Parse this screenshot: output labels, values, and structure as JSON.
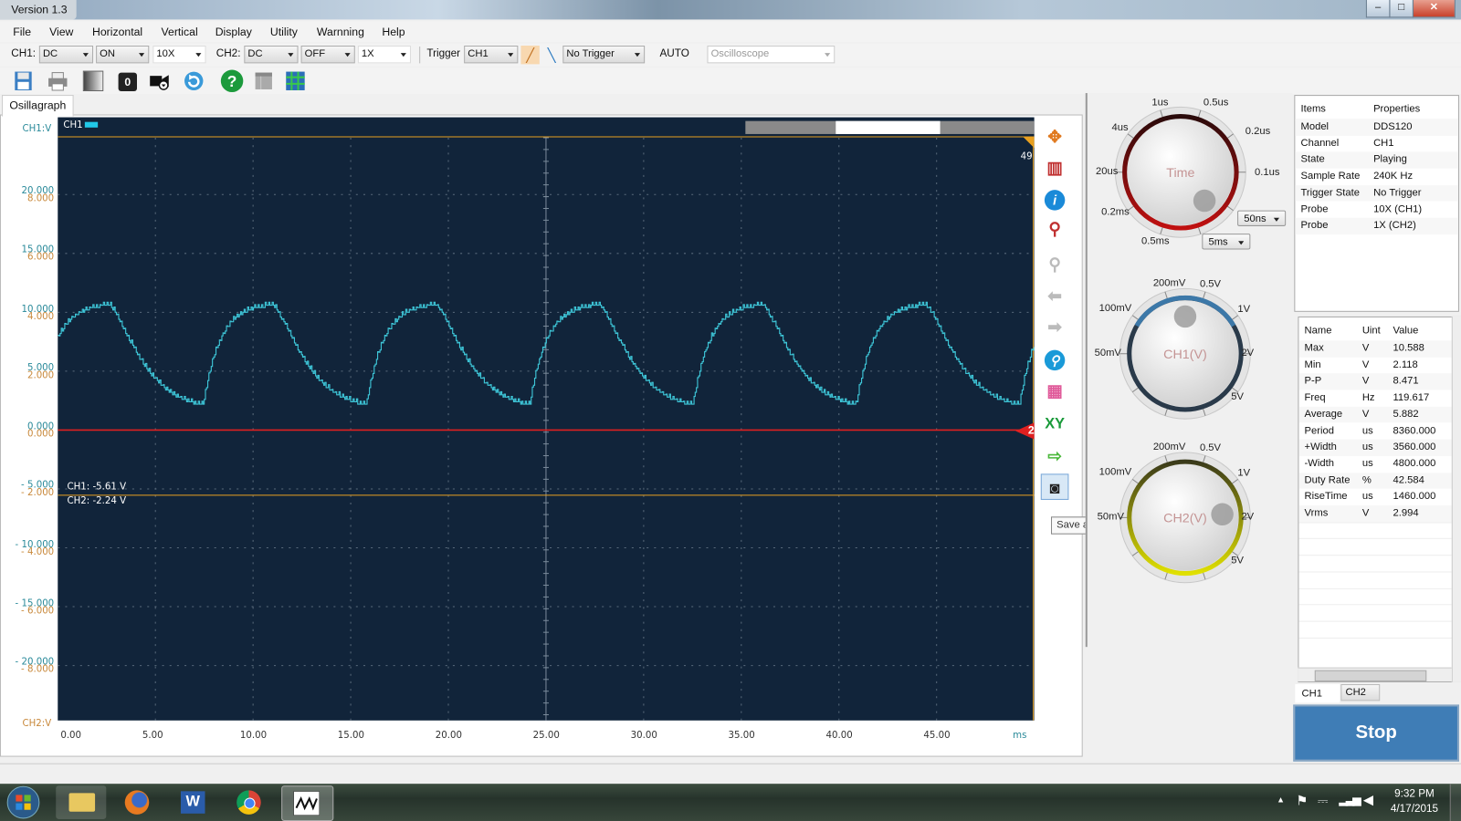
{
  "window": {
    "title": "Version 1.3",
    "controls": [
      "minimize-icon",
      "maximize-icon",
      "close-icon"
    ]
  },
  "menu": [
    "File",
    "View",
    "Horizontal",
    "Vertical",
    "Display",
    "Utility",
    "Warnning",
    "Help"
  ],
  "toolbar": {
    "ch1_label": "CH1:",
    "ch1_coupling": "DC",
    "ch1_state": "ON",
    "ch1_probe": "10X",
    "ch2_label": "CH2:",
    "ch2_coupling": "DC",
    "ch2_state": "OFF",
    "ch2_probe": "1X",
    "trigger_label": "Trigger",
    "trigger_source": "CH1",
    "trigger_mode": "No Trigger",
    "auto_label": "AUTO",
    "instrument": "Oscilloscope",
    "icons": [
      "save-icon",
      "print-icon",
      "gradient-icon",
      "zero-icon",
      "video-camera-icon",
      "refresh-icon",
      "help-icon",
      "panel-icon",
      "grid-icon"
    ]
  },
  "tab": "Osillagraph",
  "plot": {
    "header_channel": "CH1",
    "ch1_axis_title": "CH1:V",
    "ch2_axis_title": "CH2:V",
    "trigger_position_label": "49",
    "cursor_ch1": "CH1: -5.61 V",
    "cursor_ch2": "CH2: -2.24 V",
    "ch2_marker": "2",
    "x_unit": "ms",
    "colors": {
      "background": "#11243a",
      "ch1_trace": "#3ec6d8",
      "ch2_zero": "#e02020",
      "cursor": "#e8a020"
    },
    "tooltip": "Save as Jpg/Bmp/Gif",
    "side_icons": [
      "move-icon",
      "ruler-icon",
      "info-icon",
      "zoom-in-icon",
      "zoom-out-icon",
      "left-arrow-icon",
      "right-arrow-icon",
      "search-icon",
      "image-icon",
      "xy-icon",
      "export-icon",
      "camera-icon"
    ]
  },
  "chart_data": {
    "type": "line",
    "xlabel": "ms",
    "xlim": [
      0,
      50
    ],
    "x_ticks": [
      "0.00",
      "5.00",
      "10.00",
      "15.00",
      "20.00",
      "25.00",
      "30.00",
      "35.00",
      "40.00",
      "45.00"
    ],
    "y_ticks_ch1": [
      "20.000",
      "15.000",
      "10.000",
      "5.000",
      "0.000",
      "- 5.000",
      "- 10.000",
      "- 15.000",
      "- 20.000"
    ],
    "y_ticks_ch2": [
      "8.000",
      "6.000",
      "4.000",
      "2.000",
      "0.000",
      "- 2.000",
      "- 4.000",
      "- 6.000",
      "- 8.000"
    ],
    "ylim_ch1": [
      -25,
      25
    ],
    "grid": true,
    "series": [
      {
        "name": "CH1",
        "period_ms": 8.36,
        "max": 10.588,
        "min": 2.118,
        "rise_ms": 3.56,
        "fall_ms": 4.8,
        "first_min_ms": 7.45
      }
    ]
  },
  "knobs": {
    "time": {
      "label": "Time",
      "ticks": [
        "1us",
        "0.5us",
        "4us",
        "0.2us",
        "20us",
        "0.1us",
        "0.2ms",
        "0.5ms"
      ],
      "fine": "50ns",
      "coarse": "5ms",
      "color": "#c01010"
    },
    "ch1": {
      "label": "CH1(V)",
      "ticks": [
        "200mV",
        "0.5V",
        "100mV",
        "1V",
        "50mV",
        "2V",
        "5V"
      ],
      "color": "#3c78a8"
    },
    "ch2": {
      "label": "CH2(V)",
      "ticks": [
        "200mV",
        "0.5V",
        "100mV",
        "1V",
        "50mV",
        "2V",
        "5V"
      ],
      "color": "#e0e000"
    }
  },
  "properties": {
    "headers": [
      "Items",
      "Properties"
    ],
    "rows": [
      [
        "Model",
        "DDS120"
      ],
      [
        "Channel",
        "CH1"
      ],
      [
        "State",
        "Playing"
      ],
      [
        "Sample Rate",
        "240K Hz"
      ],
      [
        "Trigger State",
        "No Trigger"
      ],
      [
        "Probe",
        "10X (CH1)"
      ],
      [
        "Probe",
        "1X (CH2)"
      ]
    ]
  },
  "measurements": {
    "headers": [
      "Name",
      "Uint",
      "Value"
    ],
    "rows": [
      [
        "Max",
        "V",
        "10.588"
      ],
      [
        "Min",
        "V",
        "2.118"
      ],
      [
        "P-P",
        "V",
        "8.471"
      ],
      [
        "Freq",
        "Hz",
        "119.617"
      ],
      [
        "Average",
        "V",
        "5.882"
      ],
      [
        "Period",
        "us",
        "8360.000"
      ],
      [
        "+Width",
        "us",
        "3560.000"
      ],
      [
        "-Width",
        "us",
        "4800.000"
      ],
      [
        "Duty Rate",
        "%",
        "42.584"
      ],
      [
        "RiseTime",
        "us",
        "1460.000"
      ],
      [
        "Vrms",
        "V",
        "2.994"
      ]
    ],
    "tabs": [
      "CH1",
      "CH2"
    ]
  },
  "stop_label": "Stop",
  "taskbar": {
    "apps": [
      "windows-start-icon",
      "file-explorer-icon",
      "firefox-icon",
      "word-icon",
      "chrome-icon",
      "oscilloscope-app-icon"
    ],
    "time": "9:32 PM",
    "date": "4/17/2015"
  }
}
